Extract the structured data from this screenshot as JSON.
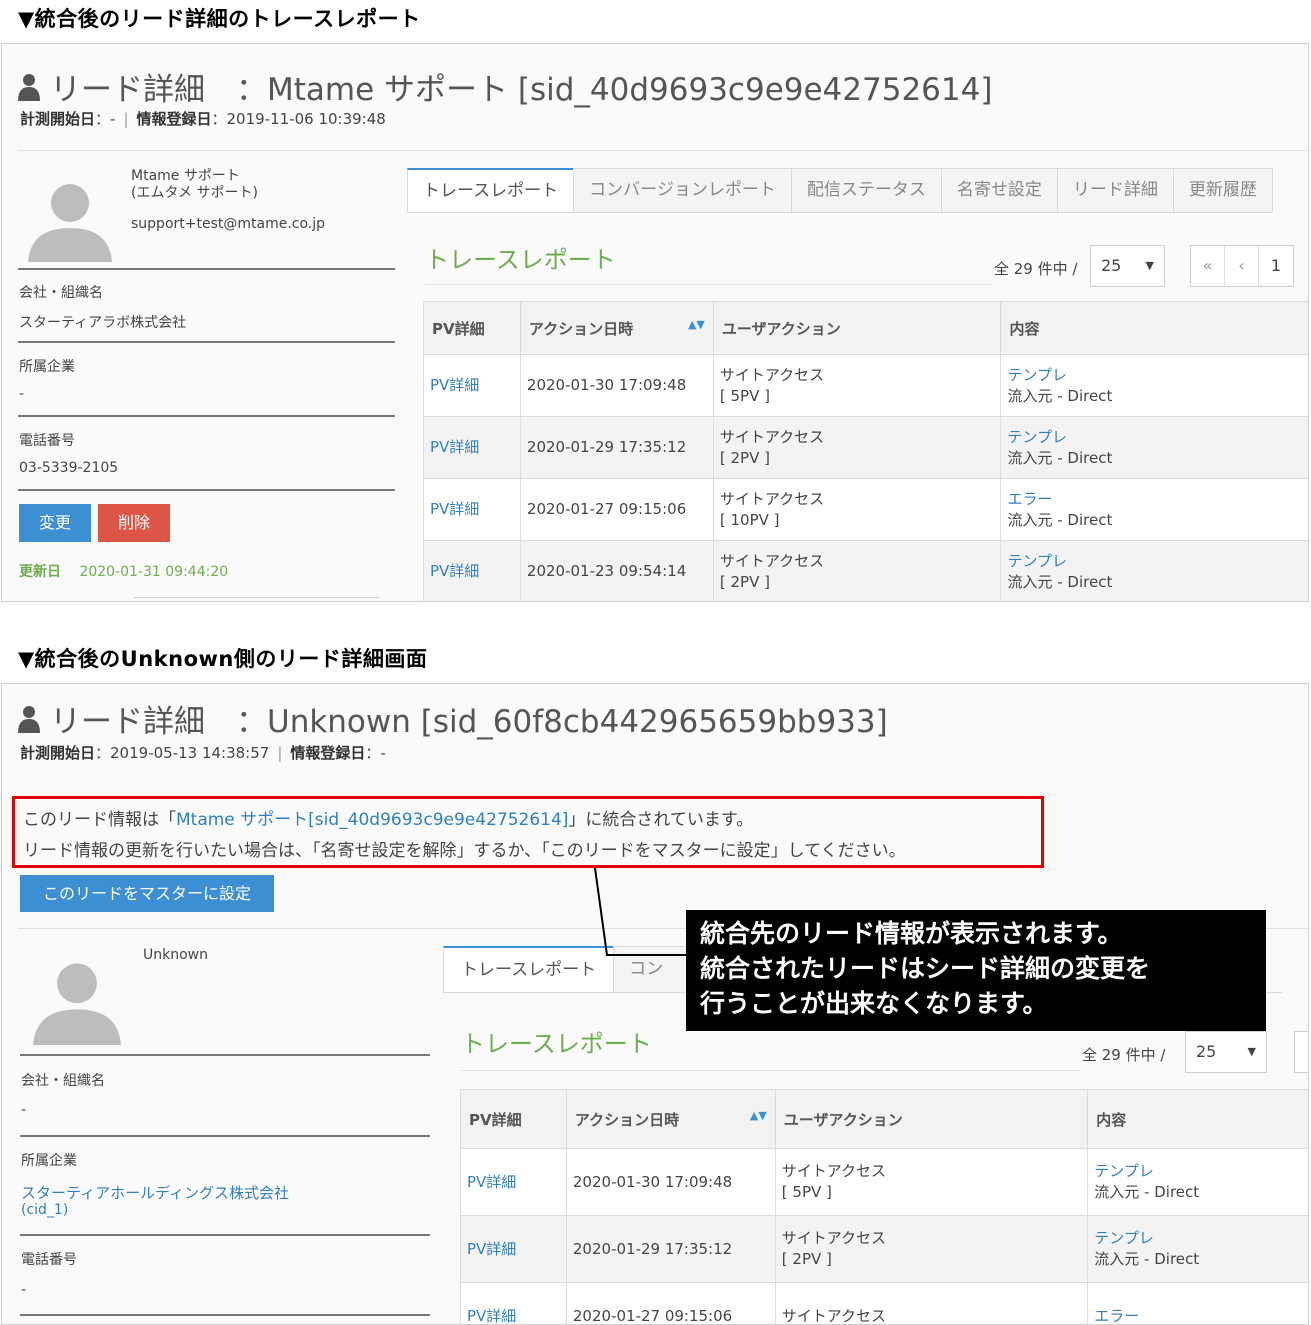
{
  "top": {
    "heading": "▼統合後のリード詳細のトレースレポート",
    "title": "リード詳細　：Mtame サポート [sid_40d9693c9e9e42752614]",
    "meta": {
      "measure_label": "計測開始日",
      "measure_value": "：-",
      "divider": "|",
      "reg_label": "情報登録日",
      "reg_value": "：2019-11-06 10:39:48"
    },
    "profile": {
      "name1": "Mtame サポート",
      "name2": "(エムタメ サポート)",
      "email": "support+test@mtame.co.jp"
    },
    "fields": {
      "company_label": "会社・組織名",
      "company_value": "スターティアラボ株式会社",
      "affil_label": "所属企業",
      "affil_value": "-",
      "phone_label": "電話番号",
      "phone_value": "03-5339-2105"
    },
    "buttons": {
      "edit": "変更",
      "delete": "削除"
    },
    "updated_label": "更新日",
    "updated_value": "2020-01-31 09:44:20",
    "tabs": [
      "トレースレポート",
      "コンバージョンレポート",
      "配信ステータス",
      "名寄せ設定",
      "リード詳細",
      "更新履歴"
    ],
    "section_title": "トレースレポート",
    "count": "全 29 件中 /",
    "per_page": "25",
    "pagination": [
      "«",
      "‹",
      "1"
    ],
    "table": {
      "headers": [
        "PV詳細",
        "アクション日時",
        "ユーザアクション",
        "内容"
      ],
      "rows": [
        {
          "pv": "PV詳細",
          "date": "2020-01-30 17:09:48",
          "act1": "サイトアクセス",
          "act2": "[ 5PV ]",
          "link": "テンプレ",
          "source": "流入元 - Direct"
        },
        {
          "pv": "PV詳細",
          "date": "2020-01-29 17:35:12",
          "act1": "サイトアクセス",
          "act2": "[ 2PV ]",
          "link": "テンプレ",
          "source": "流入元 - Direct"
        },
        {
          "pv": "PV詳細",
          "date": "2020-01-27 09:15:06",
          "act1": "サイトアクセス",
          "act2": "[ 10PV ]",
          "link": "エラー",
          "source": "流入元 - Direct"
        },
        {
          "pv": "PV詳細",
          "date": "2020-01-23 09:54:14",
          "act1": "サイトアクセス",
          "act2": "[ 2PV ]",
          "link": "テンプレ",
          "source": "流入元 - Direct"
        }
      ]
    }
  },
  "bottom": {
    "heading": "▼統合後のUnknown側のリード詳細画面",
    "title": "リード詳細　：Unknown [sid_60f8cb442965659bb933]",
    "meta": {
      "measure_label": "計測開始日",
      "measure_value": "：2019-05-13 14:38:57",
      "divider": "|",
      "reg_label": "情報登録日",
      "reg_value": "：-"
    },
    "notice": {
      "line1_pre": "このリード情報は「",
      "line1_link": "Mtame サポート[sid_40d9693c9e9e42752614]",
      "line1_post": "」に統合されています。",
      "line2": "リード情報の更新を行いたい場合は、「名寄せ設定を解除」するか、「このリードをマスターに設定」してください。"
    },
    "master_button": "このリードをマスターに設定",
    "profile": {
      "name": "Unknown"
    },
    "fields": {
      "company_label": "会社・組織名",
      "company_value": "-",
      "affil_label": "所属企業",
      "affil_value": "スターティアホールディングス株式会社",
      "affil_sub": "(cid_1)",
      "phone_label": "電話番号",
      "phone_value": "-"
    },
    "tabs": [
      "トレースレポート",
      "コン"
    ],
    "section_title": "トレースレポート",
    "count": "全 29 件中 /",
    "per_page": "25",
    "table": {
      "headers": [
        "PV詳細",
        "アクション日時",
        "ユーザアクション",
        "内容"
      ],
      "rows": [
        {
          "pv": "PV詳細",
          "date": "2020-01-30 17:09:48",
          "act1": "サイトアクセス",
          "act2": "[ 5PV ]",
          "link": "テンプレ",
          "source": "流入元 - Direct"
        },
        {
          "pv": "PV詳細",
          "date": "2020-01-29 17:35:12",
          "act1": "サイトアクセス",
          "act2": "[ 2PV ]",
          "link": "テンプレ",
          "source": "流入元 - Direct"
        },
        {
          "pv": "PV詳細",
          "date": "2020-01-27 09:15:06",
          "act1": "サイトアクセス",
          "act2": "",
          "link": "エラー",
          "source": ""
        }
      ]
    },
    "callout": [
      "統合先のリード情報が表示されます。",
      "統合されたリードはシード詳細の変更を",
      "行うことが出来なくなります。"
    ]
  }
}
